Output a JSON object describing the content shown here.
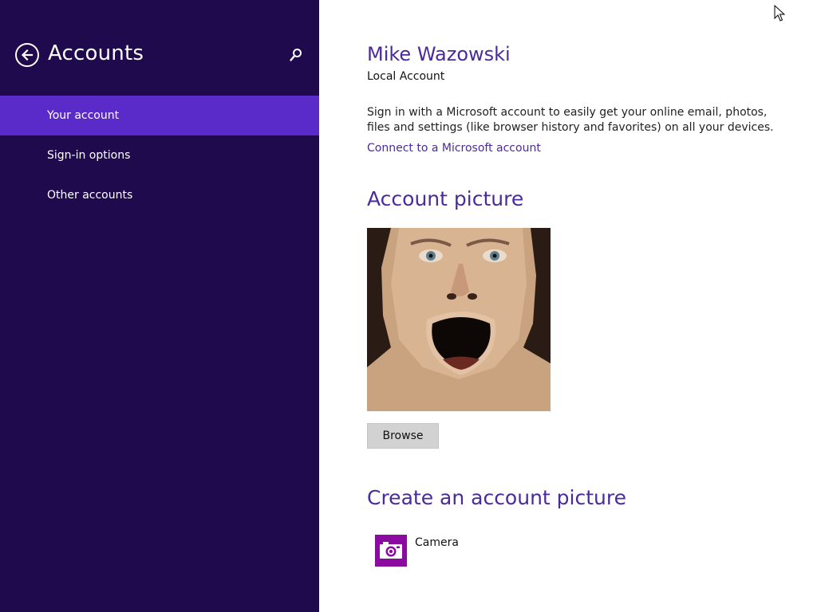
{
  "sidebar": {
    "title": "Accounts",
    "back_icon": "back-arrow-circle-icon",
    "search_icon": "search-icon",
    "items": [
      {
        "label": "Your account",
        "active": true
      },
      {
        "label": "Sign-in options",
        "active": false
      },
      {
        "label": "Other accounts",
        "active": false
      }
    ]
  },
  "account": {
    "name": "Mike Wazowski",
    "type": "Local Account",
    "signin_description": "Sign in with a Microsoft account to easily get your online email, photos, files and settings (like browser history and favorites) on all your devices.",
    "connect_link": "Connect to a Microsoft account"
  },
  "picture_section": {
    "heading": "Account picture",
    "browse_label": "Browse"
  },
  "create_section": {
    "heading": "Create an account picture",
    "camera_label": "Camera",
    "camera_icon": "camera-icon"
  },
  "colors": {
    "sidebar_bg": "#1f0a4d",
    "sidebar_active": "#5b2bc9",
    "accent_text": "#4b2a9c",
    "camera_tile": "#8b0aa0"
  }
}
